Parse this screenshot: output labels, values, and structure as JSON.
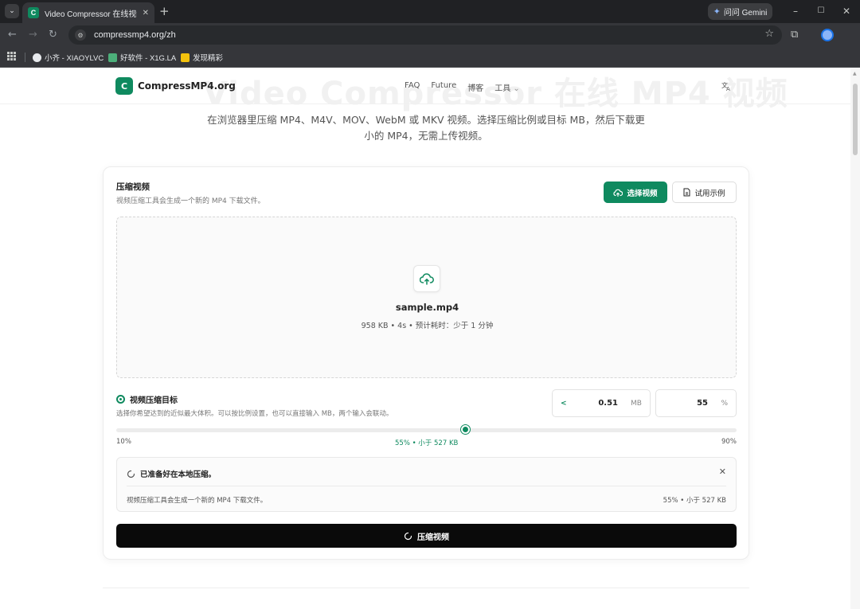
{
  "browser": {
    "tab_menu_icon": "chevron-down-icon",
    "tab": {
      "favicon_letter": "C",
      "title": "Video Compressor 在线视频压",
      "close": "✕"
    },
    "new_tab": "+",
    "gemini_label": "问问 Gemini",
    "window_controls": {
      "minimize": "–",
      "maximize": "☐",
      "close": "✕"
    },
    "url": "compressmp4.org/zh",
    "bookmarks": [
      {
        "label": "小齐 - XIAOYLVC",
        "color": "#e8eaed"
      },
      {
        "label": "好软件 - X1G.LA",
        "color": "#4caf7a"
      },
      {
        "label": "发现精彩",
        "color": "#f4c20d"
      }
    ]
  },
  "page": {
    "ghost_title": "Video Compressor 在线 MP4 视频",
    "logo_letter": "C",
    "logo_text": "CompressMP4.org",
    "nav": [
      "FAQ",
      "Future",
      "博客",
      "工具"
    ],
    "nav_dropdown_icon": "chevron-down-icon",
    "translate_icon": "translate-icon",
    "subtitle_line1": "在浏览器里压缩 MP4、M4V、MOV、WebM 或 MKV 视频。选择压缩比例或目标 MB，然后下载更",
    "subtitle_line2": "小的 MP4，无需上传视频。"
  },
  "card": {
    "title": "压缩视频",
    "desc": "视频压缩工具会生成一个新的 MP4 下载文件。",
    "select_button": "选择视频",
    "sample_button": "试用示例",
    "file": {
      "name": "sample.mp4",
      "meta": "958 KB • 4s • 预计耗时：少于 1 分钟"
    },
    "target": {
      "label": "视频压缩目标",
      "desc": "选择你希望达到的近似最大体积。可以按比例设置，也可以直接输入 MB，两个输入会联动。",
      "mb_prefix": "<",
      "mb_value": "0.51",
      "mb_unit": "MB",
      "pct_value": "55",
      "pct_unit": "%",
      "slider_min": "10%",
      "slider_max": "90%",
      "slider_readout": "55% • 小于 527 KB",
      "slider_fraction": 0.5625
    },
    "status": {
      "head": "已准备好在本地压缩。",
      "close": "✕",
      "desc": "视频压缩工具会生成一个新的 MP4 下载文件。",
      "right": "55% • 小于 527 KB"
    },
    "compress_button": "压缩视频"
  },
  "colors": {
    "accent": "#0f8a5f",
    "primary_dark": "#0a0a0a"
  }
}
